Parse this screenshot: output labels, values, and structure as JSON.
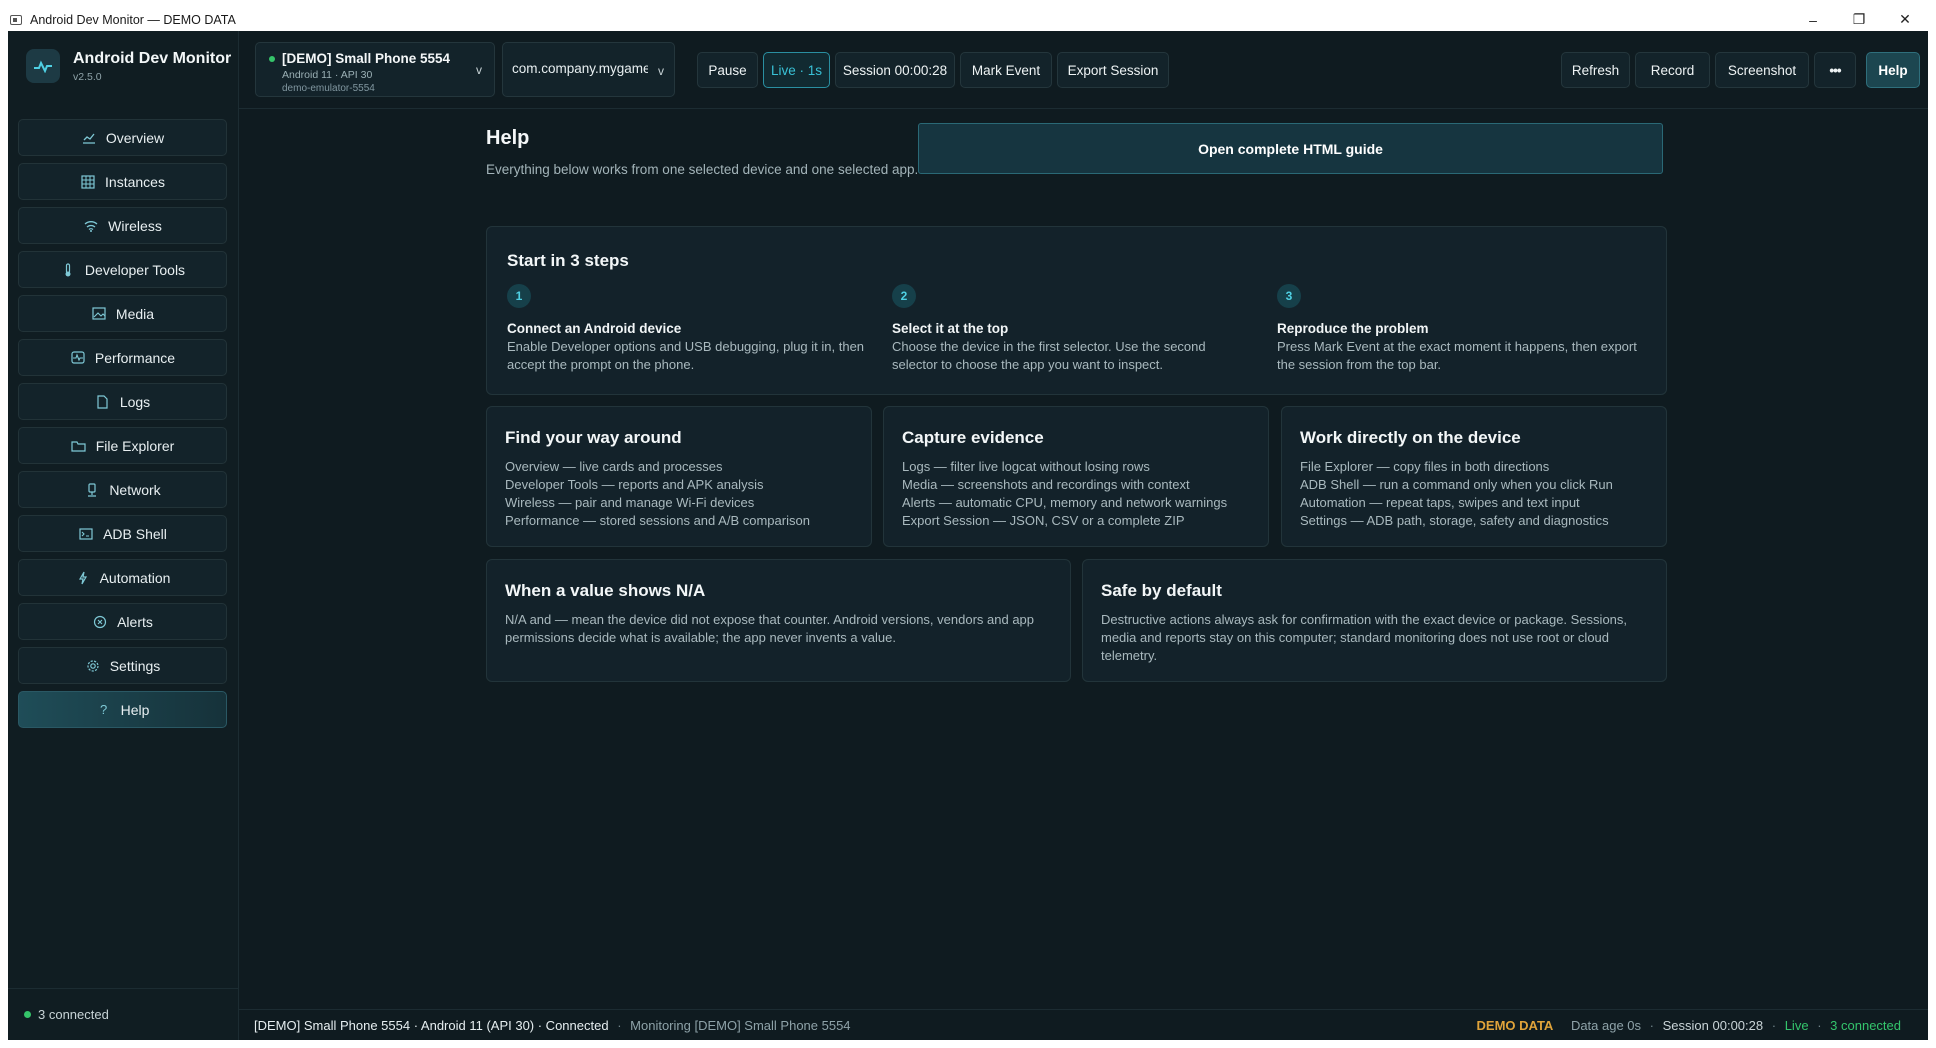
{
  "window": {
    "title": "Android Dev Monitor — DEMO DATA",
    "controls": {
      "minimize": "–",
      "maximize": "❐",
      "close": "✕"
    }
  },
  "brand": {
    "name": "Android Dev Monitor",
    "version": "v2.5.0"
  },
  "sidebar": {
    "items": [
      {
        "label": "Overview",
        "icon": "overview-icon"
      },
      {
        "label": "Instances",
        "icon": "grid-icon"
      },
      {
        "label": "Wireless",
        "icon": "wifi-icon"
      },
      {
        "label": "Developer Tools",
        "icon": "thermometer-icon"
      },
      {
        "label": "Media",
        "icon": "image-icon"
      },
      {
        "label": "Performance",
        "icon": "pulse-icon"
      },
      {
        "label": "Logs",
        "icon": "file-icon"
      },
      {
        "label": "File Explorer",
        "icon": "folder-icon"
      },
      {
        "label": "Network",
        "icon": "network-icon"
      },
      {
        "label": "ADB Shell",
        "icon": "terminal-icon"
      },
      {
        "label": "Automation",
        "icon": "automation-icon"
      },
      {
        "label": "Alerts",
        "icon": "alert-icon"
      },
      {
        "label": "Settings",
        "icon": "gear-icon"
      },
      {
        "label": "Help",
        "icon": "help-icon",
        "active": true
      }
    ],
    "footer": "3 connected"
  },
  "toolbar": {
    "device": {
      "name": "[DEMO] Small Phone 5554",
      "sub": "Android 11 · API 30",
      "id": "demo-emulator-5554"
    },
    "package": "com.company.mygame",
    "pause": "Pause",
    "live": "Live · 1s",
    "session": "Session 00:00:28",
    "mark_event": "Mark Event",
    "export_session": "Export Session",
    "refresh": "Refresh",
    "record": "Record",
    "screenshot": "Screenshot",
    "more": "•••",
    "help": "Help"
  },
  "main": {
    "title": "Help",
    "subtitle": "Everything below works from one selected device and one selected app.",
    "guide_button": "Open complete HTML guide",
    "steps_card": {
      "title": "Start in 3 steps",
      "steps": [
        {
          "num": "1",
          "title": "Connect an Android device",
          "text": "Enable Developer options and USB debugging, plug it in, then accept the prompt on the phone."
        },
        {
          "num": "2",
          "title": "Select it at the top",
          "text": "Choose the device in the first selector. Use the second selector to choose the app you want to inspect."
        },
        {
          "num": "3",
          "title": "Reproduce the problem",
          "text": "Press Mark Event at the exact moment it happens, then export the session from the top bar."
        }
      ]
    },
    "cards": [
      {
        "title": "Find your way around",
        "lines": [
          "Overview — live cards and processes",
          "Developer Tools — reports and APK analysis",
          "Wireless — pair and manage Wi-Fi devices",
          "Performance — stored sessions and A/B comparison"
        ]
      },
      {
        "title": "Capture evidence",
        "lines": [
          "Logs — filter live logcat without losing rows",
          "Media — screenshots and recordings with context",
          "Alerts — automatic CPU, memory and network warnings",
          "Export Session — JSON, CSV or a complete ZIP"
        ]
      },
      {
        "title": "Work directly on the device",
        "lines": [
          "File Explorer — copy files in both directions",
          "ADB Shell — run a command only when you click Run",
          "Automation — repeat taps, swipes and text input",
          "Settings — ADB path, storage, safety and diagnostics"
        ]
      }
    ],
    "na_card": {
      "title": "When a value shows N/A",
      "text": "N/A and — mean the device did not expose that counter. Android versions, vendors and app permissions decide what is available; the app never invents a value."
    },
    "safe_card": {
      "title": "Safe by default",
      "text": "Destructive actions always ask for confirmation with the exact device or package. Sessions, media and reports stay on this computer; standard monitoring does not use root or cloud telemetry."
    }
  },
  "statusbar": {
    "device": "[DEMO] Small Phone 5554 · Android 11 (API 30) · Connected",
    "monitoring": "Monitoring [DEMO] Small Phone 5554",
    "demo": "DEMO DATA",
    "data_age": "Data age 0s",
    "session": "Session 00:00:28",
    "live": "Live",
    "connected": "3 connected"
  },
  "colors": {
    "accent": "#39c1d6",
    "live": "#34c46c",
    "demo": "#e0a33a",
    "background": "#0f1b20"
  }
}
